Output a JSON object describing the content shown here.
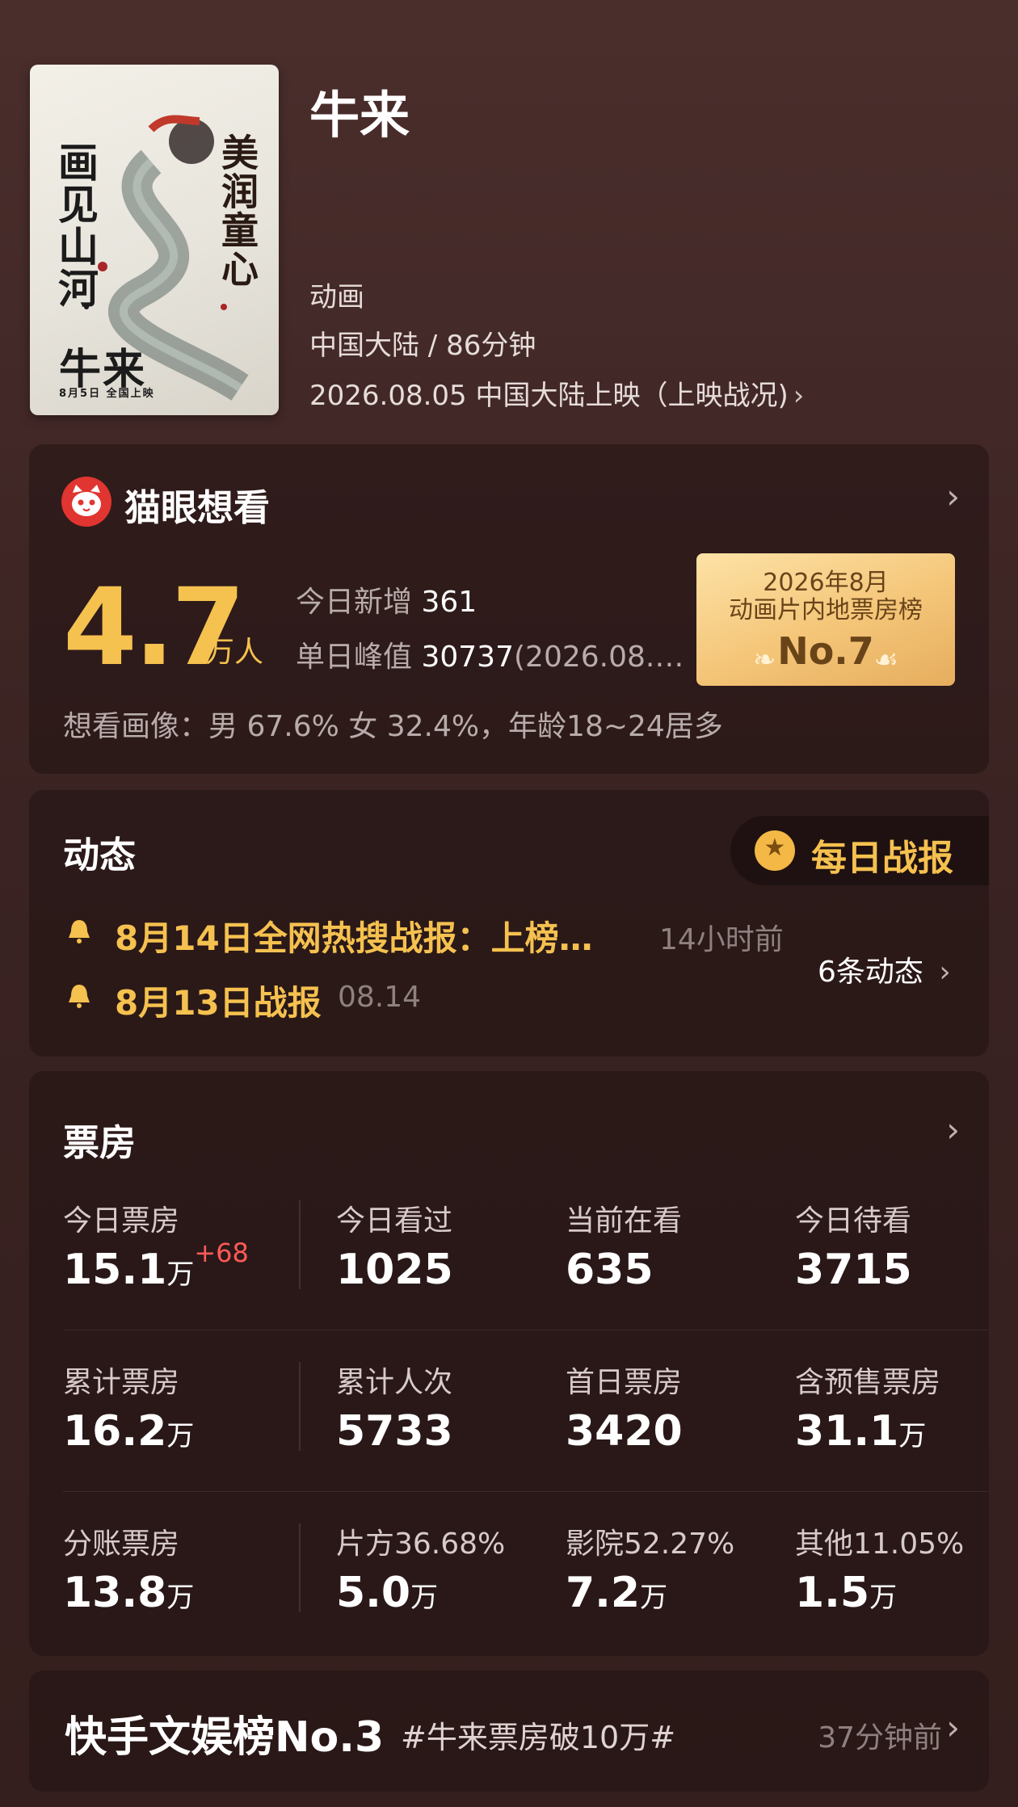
{
  "movie": {
    "title": "牛来",
    "genre": "动画",
    "region_duration": "中国大陆 / 86分钟",
    "release": "2026.08.05 中国大陆上映（上映战况)",
    "poster": {
      "left_text": "画见山河",
      "right_text": "美润童心",
      "title_text": "牛来",
      "date_text": "8月5日 全国上映"
    }
  },
  "want": {
    "brand_label": "猫眼想看",
    "count": "4.7",
    "count_unit": "万人",
    "today_label": "今日新增",
    "today_value": "361",
    "peak_label": "单日峰值",
    "peak_value": "30737",
    "peak_date": "(2026.08.…",
    "portrait": "想看画像：男 67.6%  女 32.4%，年龄18~24居多",
    "rank": {
      "line1": "2026年8月",
      "line2": "动画片内地票房榜",
      "line3": "No.7"
    }
  },
  "news": {
    "title": "动态",
    "daily_label": "每日战报",
    "items": [
      {
        "text": "8月14日全网热搜战报：上榜…",
        "time": "14小时前"
      },
      {
        "text": "8月13日战报",
        "time": "08.14"
      }
    ],
    "count_label": "6条动态"
  },
  "boxoffice": {
    "title": "票房",
    "rows": [
      [
        {
          "label": "今日票房",
          "value": "15.1",
          "unit": "万",
          "delta": "+68"
        },
        {
          "label": "今日看过",
          "value": "1025"
        },
        {
          "label": "当前在看",
          "value": "635"
        },
        {
          "label": "今日待看",
          "value": "3715"
        }
      ],
      [
        {
          "label": "累计票房",
          "value": "16.2",
          "unit": "万"
        },
        {
          "label": "累计人次",
          "value": "5733"
        },
        {
          "label": "首日票房",
          "value": "3420"
        },
        {
          "label": "含预售票房",
          "value": "31.1",
          "unit": "万"
        }
      ],
      [
        {
          "label": "分账票房",
          "value": "13.8",
          "unit": "万"
        },
        {
          "label": "片方36.68%",
          "value": "5.0",
          "unit": "万"
        },
        {
          "label": "影院52.27%",
          "value": "7.2",
          "unit": "万"
        },
        {
          "label": "其他11.05%",
          "value": "1.5",
          "unit": "万"
        }
      ]
    ]
  },
  "kuaishou": {
    "title": "快手文娱榜No.3",
    "tag": "#牛来票房破10万#",
    "time": "37分钟前"
  },
  "colors": {
    "accent_gold": "#f5c14f",
    "delta_red": "#ff5a57",
    "brand_red": "#e03530"
  }
}
